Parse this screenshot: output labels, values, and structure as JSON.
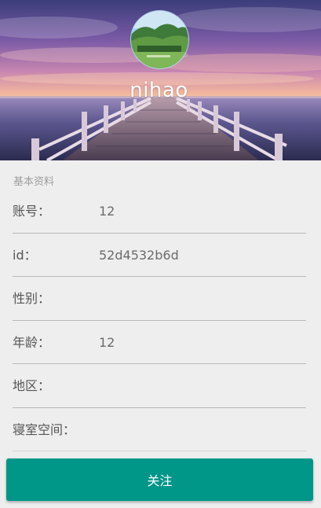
{
  "header": {
    "username": "nihao"
  },
  "profile": {
    "section_title": "基本资料",
    "rows": [
      {
        "label": "账号：",
        "value": "12"
      },
      {
        "label": "id：",
        "value": "52d4532b6d"
      },
      {
        "label": "性别：",
        "value": ""
      },
      {
        "label": "年龄：",
        "value": "12"
      },
      {
        "label": "地区：",
        "value": ""
      },
      {
        "label": "寝室空间：",
        "value": ""
      }
    ]
  },
  "actions": {
    "follow_label": "关注"
  },
  "colors": {
    "accent": "#009688",
    "background": "#eeeeee",
    "divider": "#b9b9b9"
  }
}
